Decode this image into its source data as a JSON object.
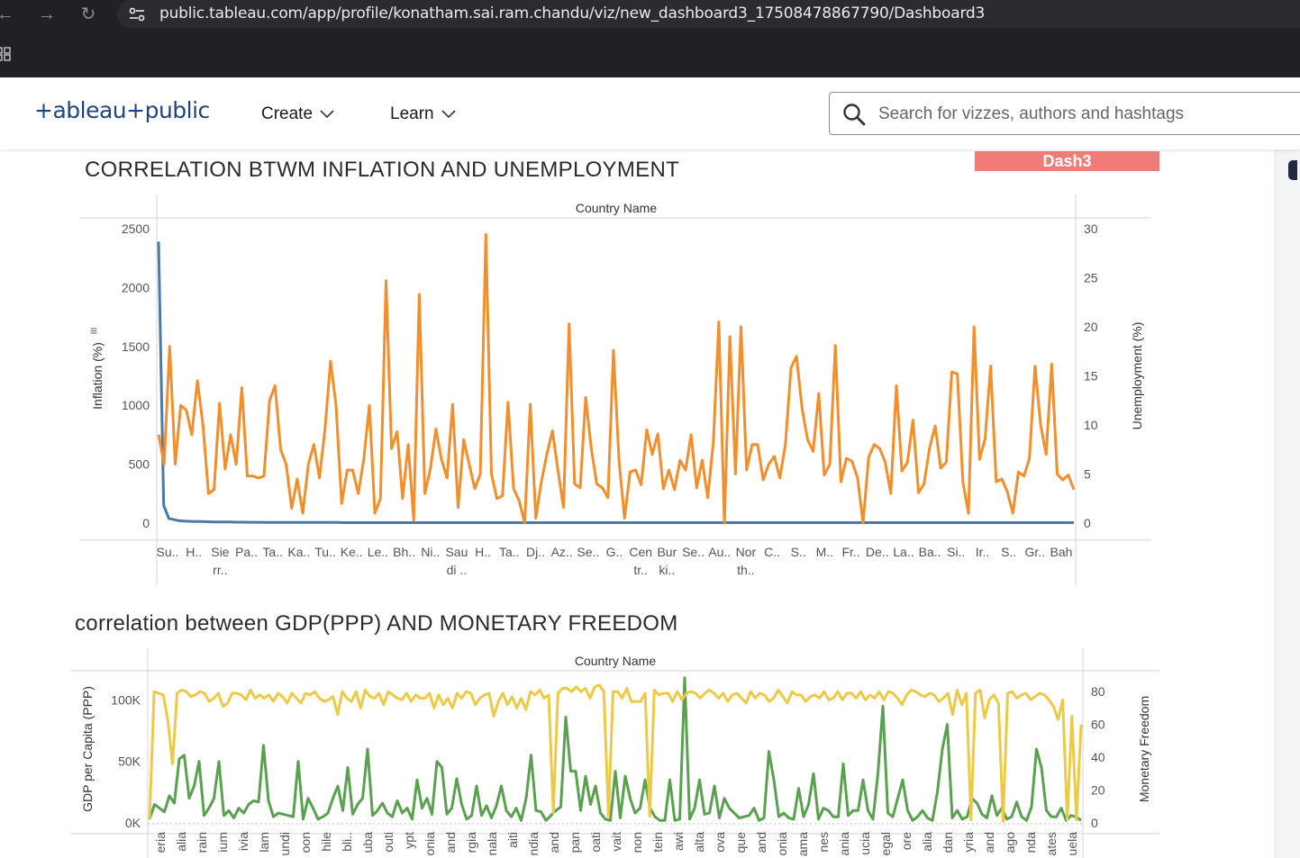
{
  "browser": {
    "url": "public.tableau.com/app/profile/konatham.sai.ram.chandu/viz/new_dashboard3_17508478867790/Dashboard3"
  },
  "header": {
    "logo": "+ableau+public",
    "nav": [
      {
        "label": "Create"
      },
      {
        "label": "Learn"
      }
    ],
    "search_placeholder": "Search for vizzes, authors and hashtags"
  },
  "dashboard": {
    "tab_label": "Dash3",
    "chart1_title": "CORRELATION BTWM INFLATION AND UNEMPLOYMENT",
    "chart2_title": "correlation between GDP(PPP) AND MONETARY FREEDOM"
  },
  "chart_data": [
    {
      "type": "line",
      "title": "CORRELATION BTWM INFLATION AND UNEMPLOYMENT",
      "xlabel": "Country Name",
      "ylabel": "Inflation (%)",
      "y2label": "Unemployment (%)",
      "ylim": [
        0,
        2500
      ],
      "y2lim": [
        0,
        30
      ],
      "yticks": [
        "2500",
        "2000",
        "1500",
        "1000",
        "500",
        "0"
      ],
      "y2ticks": [
        "30",
        "25",
        "20",
        "15",
        "10",
        "5",
        "0"
      ],
      "x_tick_labels": [
        [
          "Su.."
        ],
        [
          "H.."
        ],
        [
          "Sie",
          "rr.."
        ],
        [
          "Pa.."
        ],
        [
          "Ta.."
        ],
        [
          "Ka.."
        ],
        [
          "Tu.."
        ],
        [
          "Ke.."
        ],
        [
          "Le.."
        ],
        [
          "Bh.."
        ],
        [
          "Ni.."
        ],
        [
          "Sau",
          "di .."
        ],
        [
          "H.."
        ],
        [
          "Ta.."
        ],
        [
          "Dj.."
        ],
        [
          "Az.."
        ],
        [
          "Se.."
        ],
        [
          "G.."
        ],
        [
          "Cen",
          "tr.."
        ],
        [
          "Bur",
          "ki.."
        ],
        [
          "Se.."
        ],
        [
          "Au.."
        ],
        [
          "Nor",
          "th.."
        ],
        [
          "C.."
        ],
        [
          "S.."
        ],
        [
          "M.."
        ],
        [
          "Fr.."
        ],
        [
          "De.."
        ],
        [
          "La.."
        ],
        [
          "Ba.."
        ],
        [
          "Si.."
        ],
        [
          "Ir.."
        ],
        [
          "S.."
        ],
        [
          "Gr.."
        ],
        [
          "Bah"
        ]
      ],
      "series": [
        {
          "name": "Inflation (%)",
          "color": "#4e79a7",
          "values": [
            2390,
            150,
            40,
            30,
            20,
            17,
            15,
            14,
            13,
            12,
            11,
            10,
            10,
            9,
            9,
            8,
            8,
            8,
            7,
            7,
            7,
            6,
            6,
            6,
            6,
            5,
            5,
            5,
            5,
            5,
            5,
            5,
            5,
            5,
            5,
            5,
            4,
            4,
            4,
            4,
            4,
            4,
            4,
            4,
            4,
            4,
            4,
            4,
            4,
            4,
            4,
            4,
            4,
            4,
            4,
            4,
            4,
            4,
            4,
            4,
            4,
            4,
            4,
            4,
            4,
            4,
            4,
            4,
            4,
            4,
            4,
            4,
            4,
            4,
            4,
            4,
            4,
            4,
            4,
            4,
            4,
            4,
            4,
            4,
            4,
            4,
            4,
            4,
            4,
            4,
            4,
            4,
            4,
            4,
            4,
            4,
            4,
            4,
            4,
            4,
            4,
            4,
            4,
            4,
            4,
            4,
            4,
            4,
            4,
            4,
            4,
            4,
            4,
            4,
            4,
            4,
            4,
            4,
            4,
            4,
            4,
            4,
            4,
            4,
            4,
            4,
            4,
            4,
            4,
            4,
            4,
            4,
            4,
            4,
            4,
            4,
            4,
            4,
            4,
            4,
            4,
            4,
            4,
            4,
            4,
            4,
            4,
            4,
            4,
            4,
            4,
            4,
            4,
            4,
            4,
            4,
            4,
            4,
            4,
            4,
            4,
            4,
            4,
            4,
            4,
            4,
            4,
            4,
            4,
            4,
            4,
            4,
            4,
            4,
            4,
            4,
            4,
            4,
            4,
            4
          ]
        },
        {
          "name": "Unemployment (%)",
          "color": "#f28e2b",
          "values": [
            9,
            6,
            18,
            6,
            12,
            11.5,
            9,
            14.5,
            10,
            3,
            3.4,
            12.2,
            5.5,
            9,
            6,
            13.8,
            4.8,
            4.8,
            4.6,
            4.8,
            12.5,
            14,
            7.5,
            6,
            1.5,
            4.5,
            1,
            6,
            8,
            4.6,
            9.5,
            16.5,
            12,
            2,
            5.4,
            5.4,
            3,
            6.5,
            12,
            1,
            2.5,
            24.7,
            7.6,
            9.3,
            2.5,
            8,
            0.3,
            23.3,
            3,
            5.5,
            9.6,
            6.5,
            4.6,
            12.1,
            1.6,
            8.5,
            6,
            3.5,
            5,
            29.4,
            5,
            2.5,
            2.8,
            12.3,
            3.5,
            2.3,
            0,
            12.1,
            0.5,
            4.2,
            7,
            9.4,
            5.4,
            1.6,
            20.3,
            4,
            3.6,
            12.8,
            7.6,
            4,
            3.6,
            2.6,
            17.6,
            6.4,
            0.5,
            5.2,
            5.4,
            3.9,
            9.5,
            7,
            9.1,
            3.5,
            5.4,
            3.4,
            6.4,
            5.4,
            9,
            3.6,
            6.4,
            2.6,
            8.2,
            20.5,
            0,
            19,
            5,
            20,
            5.4,
            8,
            8,
            4.4,
            6,
            6.8,
            4.6,
            8,
            15.8,
            17,
            11.7,
            8.5,
            7.3,
            13.2,
            4.9,
            6,
            18.1,
            4.2,
            6.6,
            6.3,
            4.6,
            0,
            6.7,
            8,
            7.6,
            6.2,
            3,
            14,
            5.3,
            6.2,
            10.5,
            3.1,
            4,
            7.7,
            9.9,
            5.6,
            6.2,
            15.4,
            15.2,
            4.2,
            1,
            20,
            6.5,
            8.6,
            16,
            4.2,
            4.5,
            3.2,
            1,
            5.2,
            4.8,
            6.6,
            16,
            10,
            7,
            16.2,
            5,
            4.4,
            4.9,
            3.4
          ]
        }
      ]
    },
    {
      "type": "line",
      "title": "correlation between GDP(PPP) AND MONETARY FREEDOM",
      "xlabel": "Country Name",
      "ylabel": "GDP per Capita (PPP)",
      "y2label": "Monetary Freedom",
      "ylim": [
        0,
        120000
      ],
      "y2lim": [
        0,
        90
      ],
      "yticks": [
        "100K",
        "50K",
        "0K"
      ],
      "y2ticks": [
        "80",
        "60",
        "40",
        "20",
        "0"
      ],
      "x_tick_labels": [
        "eria",
        "alia",
        "rain",
        "ium",
        "ivia",
        "lam",
        "undi",
        "oon",
        "hile",
        "bli..",
        "uba",
        "outi",
        "ypt",
        "onia",
        "and",
        "rgia",
        "nala",
        "aiti",
        "ndia",
        "and",
        "pan",
        "oati",
        "vait",
        "non",
        "tein",
        "awi",
        "alta",
        "ova",
        "que",
        "and",
        "onia",
        "ama",
        "nes",
        "ania",
        "ucia",
        "egal",
        "ore",
        "alia",
        "dan",
        "yria",
        "and",
        "ago",
        "nda",
        "ates",
        "uela"
      ],
      "series": [
        {
          "name": "GDP per Capita (PPP)",
          "color": "#59a14f",
          "values": [
            3000,
            15000,
            12000,
            9000,
            22000,
            16000,
            52000,
            55000,
            20000,
            30000,
            50000,
            6000,
            12000,
            20000,
            50000,
            6000,
            10000,
            4000,
            12000,
            8000,
            15000,
            18000,
            17000,
            63000,
            18000,
            5000,
            8000,
            7000,
            6000,
            5000,
            50000,
            3000,
            20000,
            12000,
            3000,
            5000,
            8000,
            20000,
            30000,
            10000,
            45000,
            7000,
            15000,
            20000,
            60000,
            6000,
            10000,
            16000,
            8000,
            5000,
            18000,
            8000,
            12000,
            3000,
            35000,
            12000,
            20000,
            7000,
            50000,
            45000,
            7000,
            12000,
            36000,
            15000,
            3000,
            6000,
            30000,
            6000,
            14000,
            4000,
            14000,
            30000,
            10000,
            5000,
            12000,
            2000,
            20000,
            55000,
            10000,
            9000,
            2000,
            6000,
            10000,
            13000,
            86000,
            42000,
            42000,
            10000,
            38000,
            15000,
            30000,
            8000,
            3000,
            2000,
            42000,
            4000,
            38000,
            20000,
            8000,
            12000,
            35000,
            12000,
            5000,
            2000,
            2000,
            35000,
            2000,
            3000,
            118000,
            3000,
            12000,
            35000,
            7000,
            8000,
            30000,
            4000,
            20000,
            12000,
            8000,
            4000,
            5000,
            6000,
            12000,
            2000,
            4000,
            58000,
            35000,
            5000,
            8000,
            4000,
            3000,
            28000,
            5000,
            15000,
            40000,
            3000,
            12000,
            10000,
            5000,
            5000,
            48000,
            6000,
            10000,
            10000,
            35000,
            10000,
            3000,
            40000,
            95000,
            8000,
            5000,
            20000,
            35000,
            10000,
            2000,
            5000,
            10000,
            4000,
            2000,
            25000,
            60000,
            80000,
            4000,
            10000,
            3000,
            5000,
            20000,
            16000,
            7000,
            4000,
            22000,
            6000,
            12000,
            3000,
            5000,
            17000,
            5000,
            2000,
            13000,
            60000,
            45000,
            10000,
            5000,
            5000,
            12000,
            2000,
            6000,
            5000,
            2000
          ]
        },
        {
          "name": "Monetary Freedom",
          "color": "#edc948",
          "values": [
            2,
            80,
            79,
            78,
            62,
            36,
            79,
            81,
            80,
            77,
            78,
            80,
            79,
            74,
            76,
            79,
            71,
            73,
            79,
            79,
            78,
            75,
            81,
            76,
            78,
            76,
            78,
            74,
            79,
            77,
            73,
            79,
            76,
            73,
            79,
            78,
            80,
            76,
            74,
            75,
            77,
            66,
            80,
            76,
            74,
            80,
            70,
            81,
            77,
            76,
            79,
            72,
            80,
            78,
            76,
            75,
            79,
            74,
            78,
            76,
            76,
            79,
            70,
            78,
            72,
            76,
            70,
            79,
            76,
            80,
            79,
            72,
            76,
            78,
            79,
            65,
            74,
            79,
            72,
            77,
            70,
            76,
            69,
            80,
            78,
            81,
            76,
            78,
            6,
            79,
            82,
            82,
            80,
            83,
            80,
            82,
            76,
            83,
            84,
            80,
            4,
            80,
            80,
            76,
            82,
            74,
            74,
            74,
            79,
            4,
            81,
            78,
            79,
            79,
            74,
            80,
            75,
            79,
            80,
            79,
            76,
            79,
            81,
            79,
            76,
            79,
            74,
            78,
            79,
            76,
            73,
            80,
            76,
            79,
            78,
            74,
            76,
            81,
            77,
            73,
            80,
            78,
            78,
            74,
            77,
            78,
            76,
            80,
            75,
            76,
            80,
            75,
            79,
            79,
            76,
            80,
            75,
            78,
            76,
            80,
            75,
            80,
            79,
            76,
            72,
            78,
            81,
            80,
            78,
            77,
            79,
            78,
            74,
            76,
            79,
            66,
            81,
            72,
            79,
            2,
            79,
            81,
            64,
            75,
            78,
            73,
            1,
            79,
            80,
            76,
            78,
            79,
            75,
            77,
            79,
            78,
            75,
            71,
            63,
            75,
            2,
            65,
            2,
            60
          ]
        }
      ]
    }
  ]
}
